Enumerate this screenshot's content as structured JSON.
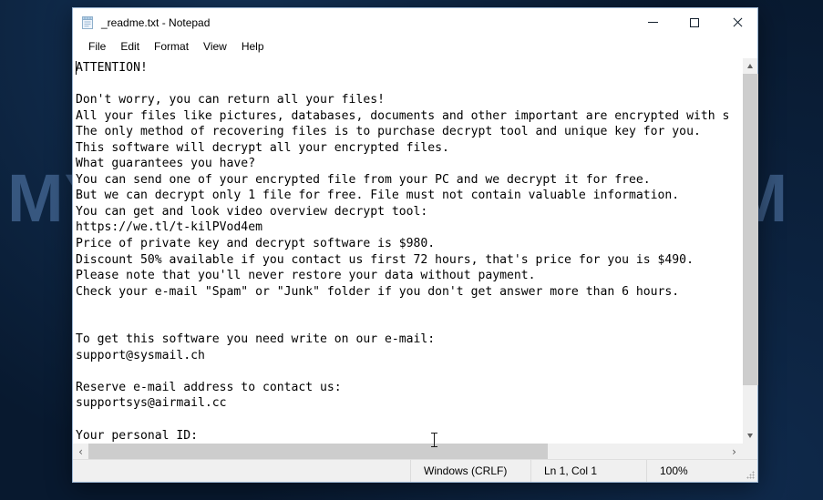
{
  "desktop": {
    "background_color": "#08192f",
    "watermark_text": "MYANTISPYWARE.COM",
    "watermark_color": "#78a5e1"
  },
  "window": {
    "title": "_readme.txt - Notepad",
    "icon": "notepad-icon",
    "controls": {
      "minimize": "–",
      "maximize": "□",
      "close": "✕"
    }
  },
  "menubar": {
    "items": [
      {
        "label": "File"
      },
      {
        "label": "Edit"
      },
      {
        "label": "Format"
      },
      {
        "label": "View"
      },
      {
        "label": "Help"
      }
    ]
  },
  "editor": {
    "content": "ATTENTION!\n\nDon't worry, you can return all your files!\nAll your files like pictures, databases, documents and other important are encrypted with s\nThe only method of recovering files is to purchase decrypt tool and unique key for you.\nThis software will decrypt all your encrypted files.\nWhat guarantees you have?\nYou can send one of your encrypted file from your PC and we decrypt it for free.\nBut we can decrypt only 1 file for free. File must not contain valuable information.\nYou can get and look video overview decrypt tool:\nhttps://we.tl/t-kilPVod4em\nPrice of private key and decrypt software is $980.\nDiscount 50% available if you contact us first 72 hours, that's price for you is $490.\nPlease note that you'll never restore your data without payment.\nCheck your e-mail \"Spam\" or \"Junk\" folder if you don't get answer more than 6 hours.\n\n\nTo get this software you need write on our e-mail:\nsupport@sysmail.ch\n\nReserve e-mail address to contact us:\nsupportsys@airmail.cc\n\nYour personal ID:",
    "lines": [
      "ATTENTION!",
      "",
      "Don't worry, you can return all your files!",
      "All your files like pictures, databases, documents and other important are encrypted with s",
      "The only method of recovering files is to purchase decrypt tool and unique key for you.",
      "This software will decrypt all your encrypted files.",
      "What guarantees you have?",
      "You can send one of your encrypted file from your PC and we decrypt it for free.",
      "But we can decrypt only 1 file for free. File must not contain valuable information.",
      "You can get and look video overview decrypt tool:",
      "https://we.tl/t-kilPVod4em",
      "Price of private key and decrypt software is $980.",
      "Discount 50% available if you contact us first 72 hours, that's price for you is $490.",
      "Please note that you'll never restore your data without payment.",
      "Check your e-mail \"Spam\" or \"Junk\" folder if you don't get answer more than 6 hours.",
      "",
      "",
      "To get this software you need write on our e-mail:",
      "support@sysmail.ch",
      "",
      "Reserve e-mail address to contact us:",
      "supportsys@airmail.cc",
      "",
      "Your personal ID:"
    ],
    "ransom_details": {
      "price_full": "$980",
      "price_discount": "$490",
      "discount_percent": "50%",
      "discount_window": "72 hours",
      "response_time": "6 hours",
      "video_url": "https://we.tl/t-kilPVod4em",
      "email_primary": "support@sysmail.ch",
      "email_reserve": "supportsys@airmail.cc"
    }
  },
  "scrollbars": {
    "vertical": {
      "up_arrow": "˄",
      "down_arrow": "˅",
      "thumb_percent": 88
    },
    "horizontal": {
      "left_arrow": "‹",
      "right_arrow": "›",
      "thumb_percent": 72
    }
  },
  "statusbar": {
    "line_ending": "Windows (CRLF)",
    "cursor_position": "Ln 1, Col 1",
    "zoom": "100%"
  }
}
